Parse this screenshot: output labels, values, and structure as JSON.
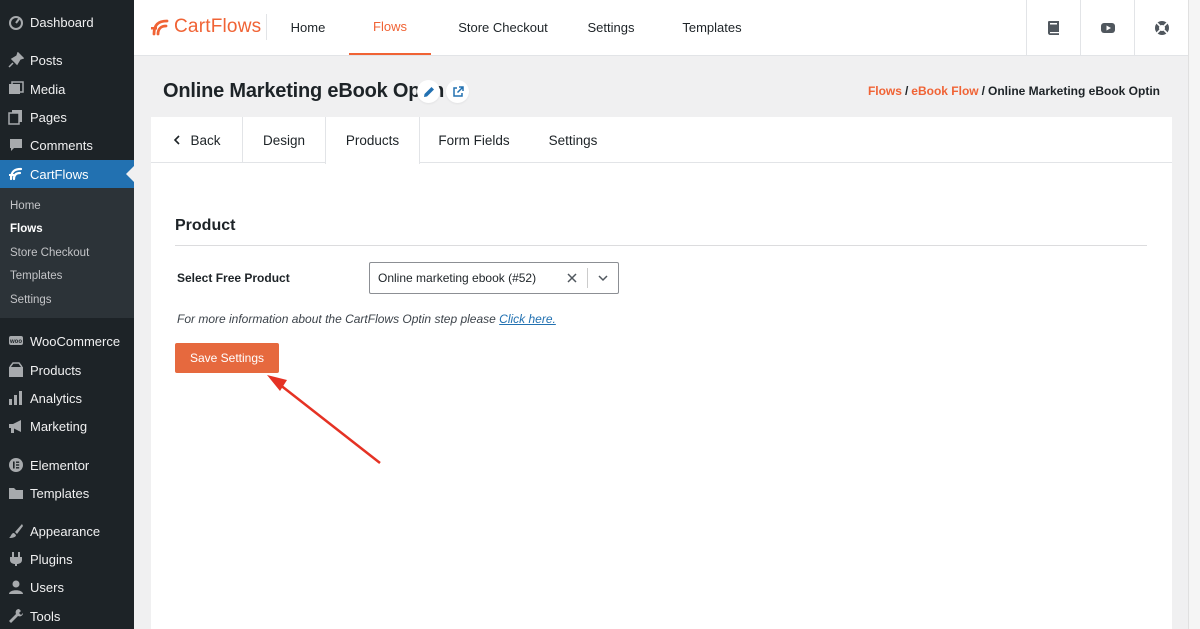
{
  "sidebar": {
    "items": [
      {
        "label": "Dashboard",
        "icon": "dashboard-icon"
      },
      {
        "label": "Posts",
        "icon": "pin-icon"
      },
      {
        "label": "Media",
        "icon": "media-icon"
      },
      {
        "label": "Pages",
        "icon": "pages-icon"
      },
      {
        "label": "Comments",
        "icon": "comment-icon"
      },
      {
        "label": "CartFlows",
        "icon": "cartflows-icon",
        "active": true
      },
      {
        "label": "WooCommerce",
        "icon": "woo-icon"
      },
      {
        "label": "Products",
        "icon": "products-icon"
      },
      {
        "label": "Analytics",
        "icon": "analytics-icon"
      },
      {
        "label": "Marketing",
        "icon": "megaphone-icon"
      },
      {
        "label": "Elementor",
        "icon": "elementor-icon"
      },
      {
        "label": "Templates",
        "icon": "folder-icon"
      },
      {
        "label": "Appearance",
        "icon": "paintbrush-icon"
      },
      {
        "label": "Plugins",
        "icon": "plugin-icon"
      },
      {
        "label": "Users",
        "icon": "user-icon"
      },
      {
        "label": "Tools",
        "icon": "wrench-icon"
      }
    ],
    "submenu": [
      {
        "label": "Home"
      },
      {
        "label": "Flows",
        "current": true
      },
      {
        "label": "Store Checkout"
      },
      {
        "label": "Templates"
      },
      {
        "label": "Settings"
      }
    ]
  },
  "topnav": {
    "logo_text": "CartFlows",
    "tabs": [
      {
        "label": "Home"
      },
      {
        "label": "Flows",
        "active": true
      },
      {
        "label": "Store Checkout"
      },
      {
        "label": "Settings"
      },
      {
        "label": "Templates"
      }
    ],
    "icon_buttons": [
      "book-icon",
      "video-icon",
      "support-icon"
    ]
  },
  "header": {
    "title": "Online Marketing eBook Optin",
    "breadcrumb": [
      {
        "label": "Flows",
        "link": true
      },
      {
        "label": "eBook Flow",
        "link": true
      },
      {
        "label": "Online Marketing eBook Optin",
        "link": false
      }
    ],
    "separator": "/"
  },
  "step_tabs": {
    "back_label": "Back",
    "tabs": [
      {
        "label": "Design"
      },
      {
        "label": "Products",
        "active": true
      },
      {
        "label": "Form Fields"
      },
      {
        "label": "Settings"
      }
    ]
  },
  "product_section": {
    "title": "Product",
    "field_label": "Select Free Product",
    "selected_value": "Online marketing ebook (#52)",
    "help_text": "For more information about the CartFlows Optin step please ",
    "help_link": "Click here.",
    "save_label": "Save Settings"
  },
  "colors": {
    "accent": "#f06335",
    "save_button": "#e6693e",
    "sidebar_bg": "#1d2327",
    "active_menu": "#2271b1",
    "link": "#2271b1",
    "annotation_arrow": "#e53224"
  }
}
